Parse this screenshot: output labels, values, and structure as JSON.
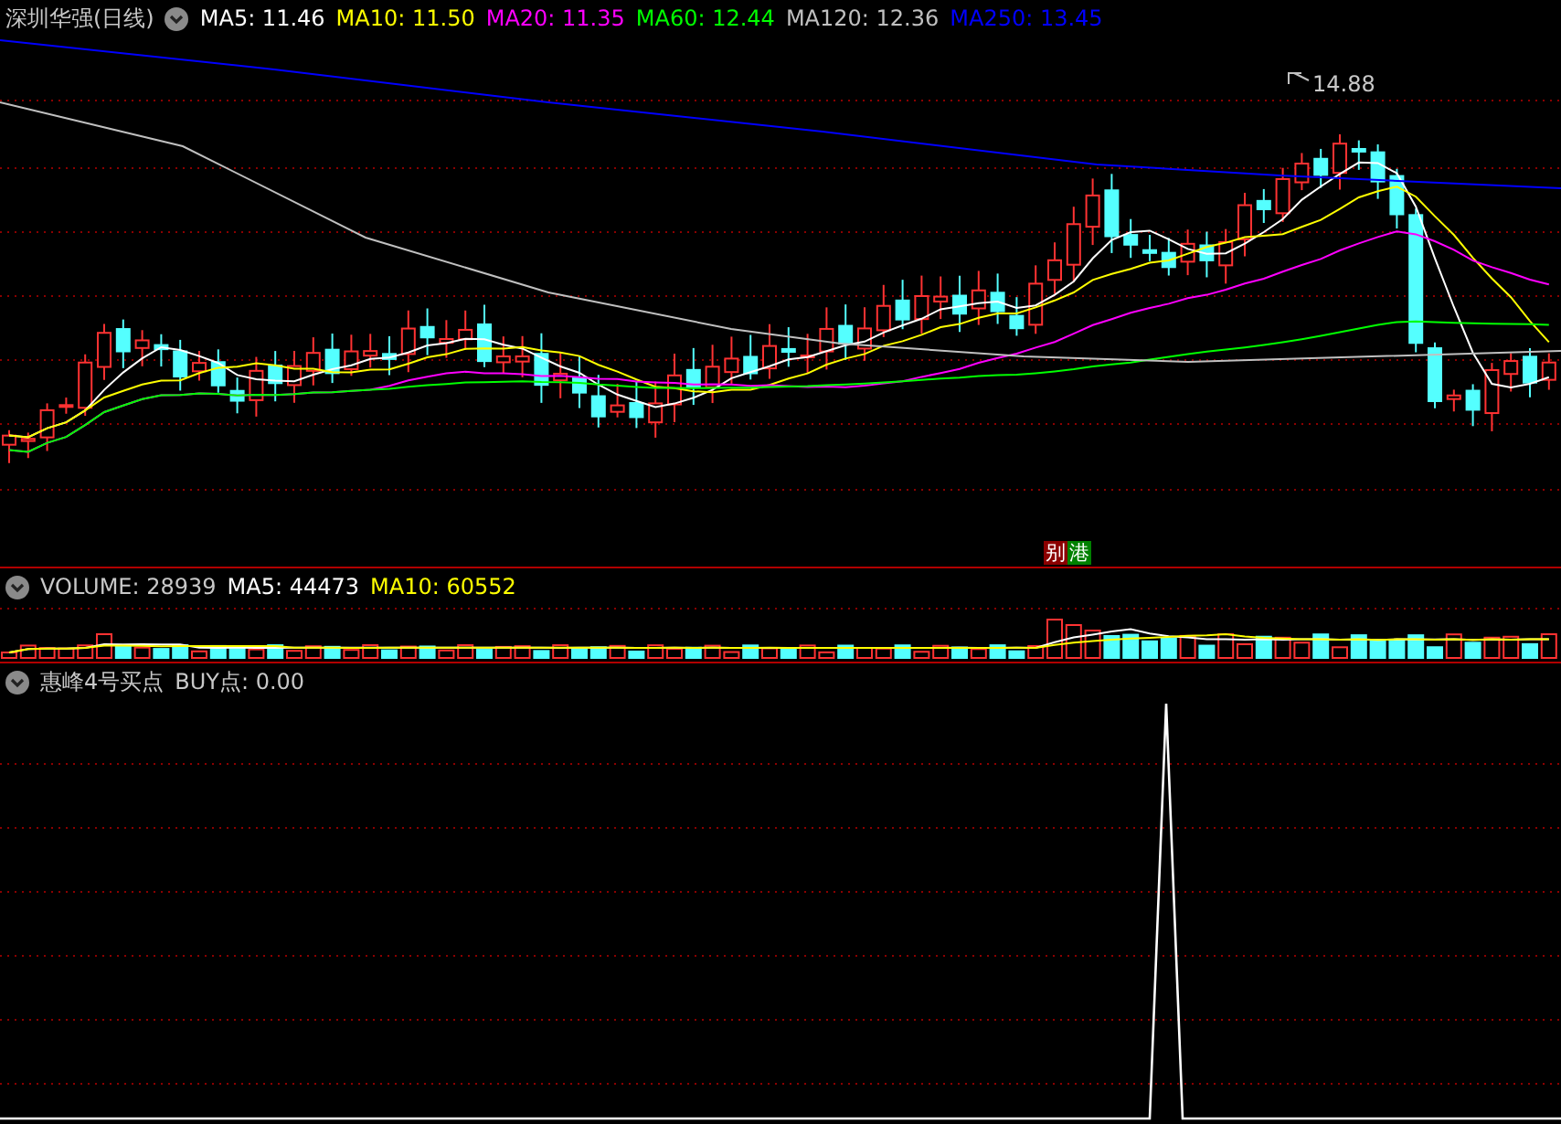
{
  "price_panel": {
    "title": "深圳华强(日线)",
    "moving_averages": [
      {
        "label": "MA5: 11.46",
        "color": "#ffffff"
      },
      {
        "label": "MA10: 11.50",
        "color": "#ffff00"
      },
      {
        "label": "MA20: 11.35",
        "color": "#ff00ff"
      },
      {
        "label": "MA60: 12.44",
        "color": "#00ff00"
      },
      {
        "label": "MA120: 12.36",
        "color": "#c0c0c0"
      },
      {
        "label": "MA250: 13.45",
        "color": "#0000ff"
      }
    ],
    "high_label": "14.88",
    "event_marks": [
      {
        "text": "别",
        "color": "#8b0000"
      },
      {
        "text": "港",
        "color": "#008000"
      }
    ]
  },
  "volume_panel": {
    "title": "VOLUME: 28939",
    "indicators": [
      {
        "label": "MA5: 44473",
        "color": "#ffffff"
      },
      {
        "label": "MA10: 60552",
        "color": "#ffff00"
      }
    ]
  },
  "indicator_panel": {
    "title": "惠峰4号买点",
    "reading": "BUY点: 0.00"
  }
}
